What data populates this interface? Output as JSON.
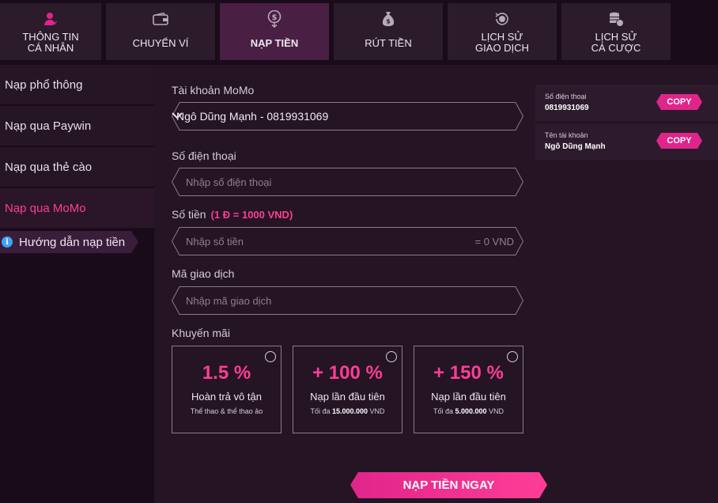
{
  "tabs": [
    {
      "label": "THÔNG TIN\nCÁ NHÂN",
      "icon": "user-icon"
    },
    {
      "label": "CHUYỂN VÍ",
      "icon": "wallet-icon"
    },
    {
      "label": "NẠP TIỀN",
      "icon": "deposit-coin-icon"
    },
    {
      "label": "RÚT TIỀN",
      "icon": "money-bag-icon"
    },
    {
      "label": "LỊCH SỬ\nGIAO DỊCH",
      "icon": "history-coin-icon"
    },
    {
      "label": "LỊCH SỬ\nCÁ CƯỢC",
      "icon": "coins-stack-icon"
    }
  ],
  "sidebar": {
    "items": [
      {
        "label": "Nạp phổ thông"
      },
      {
        "label": "Nạp qua Paywin"
      },
      {
        "label": "Nạp qua thẻ cào"
      },
      {
        "label": "Nạp qua MoMo"
      }
    ],
    "guide_label": "Hướng dẫn nạp tiền",
    "guide_icon_glyph": "i"
  },
  "form": {
    "account_label": "Tài khoản MoMo",
    "account_value": "Ngô Dũng Mạnh - 0819931069",
    "phone_label": "Số điện thoại",
    "phone_placeholder": "Nhập số điện thoại",
    "amount_label": "Số tiền",
    "amount_rate": "(1 Đ = 1000 VND)",
    "amount_placeholder": "Nhập số tiền",
    "amount_suffix": "= 0 VND",
    "code_label": "Mã giao dịch",
    "code_placeholder": "Nhập mã giao dịch",
    "promo_label": "Khuyến mãi",
    "promos": [
      {
        "pct": "1.5 %",
        "title": "Hoàn trả vô tận",
        "sub_prefix": "Thể thao & thể thao ảo",
        "sub_bold": "",
        "sub_suffix": ""
      },
      {
        "pct": "+ 100 %",
        "title": "Nạp lần đầu tiên",
        "sub_prefix": "Tối đa ",
        "sub_bold": "15.000.000",
        "sub_suffix": " VND"
      },
      {
        "pct": "+ 150 %",
        "title": "Nạp lần đầu tiên",
        "sub_prefix": "Tối đa ",
        "sub_bold": "5.000.000",
        "sub_suffix": " VND"
      }
    ],
    "submit_label": "NẠP TIỀN NGAY"
  },
  "info": [
    {
      "key": "Số điện thoại",
      "value": "0819931069",
      "copy": "COPY"
    },
    {
      "key": "Tên tài khoản",
      "value": "Ngô Dũng Mạnh",
      "copy": "COPY"
    }
  ],
  "colors": {
    "accent": "#ff3d97",
    "active_tab": "#4a1f44",
    "background": "#1a0b1a"
  }
}
